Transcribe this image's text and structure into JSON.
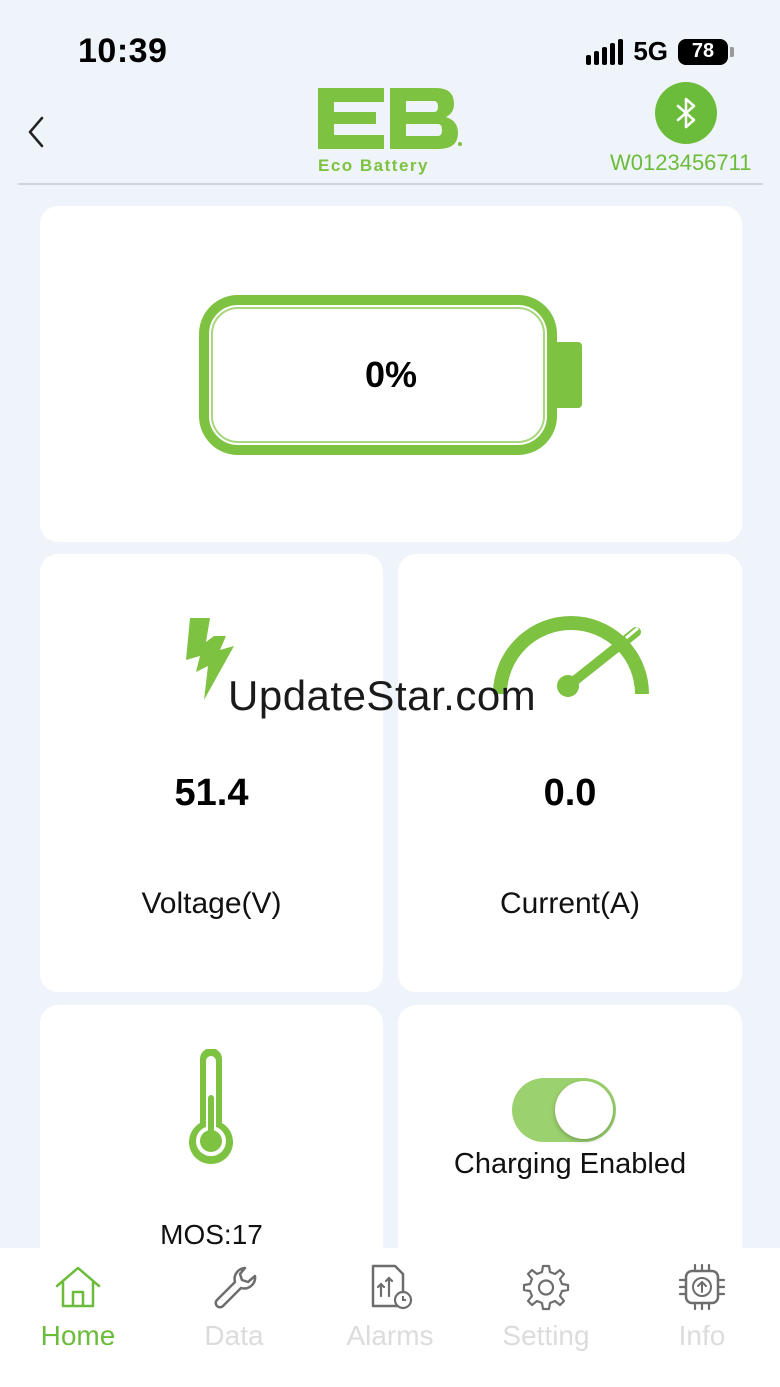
{
  "status_bar": {
    "time": "10:39",
    "network": "5G",
    "battery": "78"
  },
  "header": {
    "logo_text": "Eco Battery",
    "device_id": "W0123456711"
  },
  "battery": {
    "percent": "0%",
    "level": 0
  },
  "metrics": {
    "voltage": {
      "value": "51.4",
      "label": "Voltage(V)"
    },
    "current": {
      "value": "0.0",
      "label": "Current(A)"
    },
    "temperature": {
      "label": "MOS:17"
    },
    "charging": {
      "label": "Charging Enabled",
      "enabled": true
    }
  },
  "watermark": "UpdateStar.com",
  "tabs": [
    {
      "label": "Home",
      "icon": "home-icon",
      "active": true
    },
    {
      "label": "Data",
      "icon": "wrench-icon",
      "active": false
    },
    {
      "label": "Alarms",
      "icon": "alarm-report-icon",
      "active": false
    },
    {
      "label": "Setting",
      "icon": "gear-icon",
      "active": false
    },
    {
      "label": "Info",
      "icon": "chip-icon",
      "active": false
    }
  ],
  "colors": {
    "accent": "#6cbc3b",
    "toggle_track": "#9bd16e",
    "background": "#eef4f9",
    "inactive_tab": "#dcdcdc"
  }
}
